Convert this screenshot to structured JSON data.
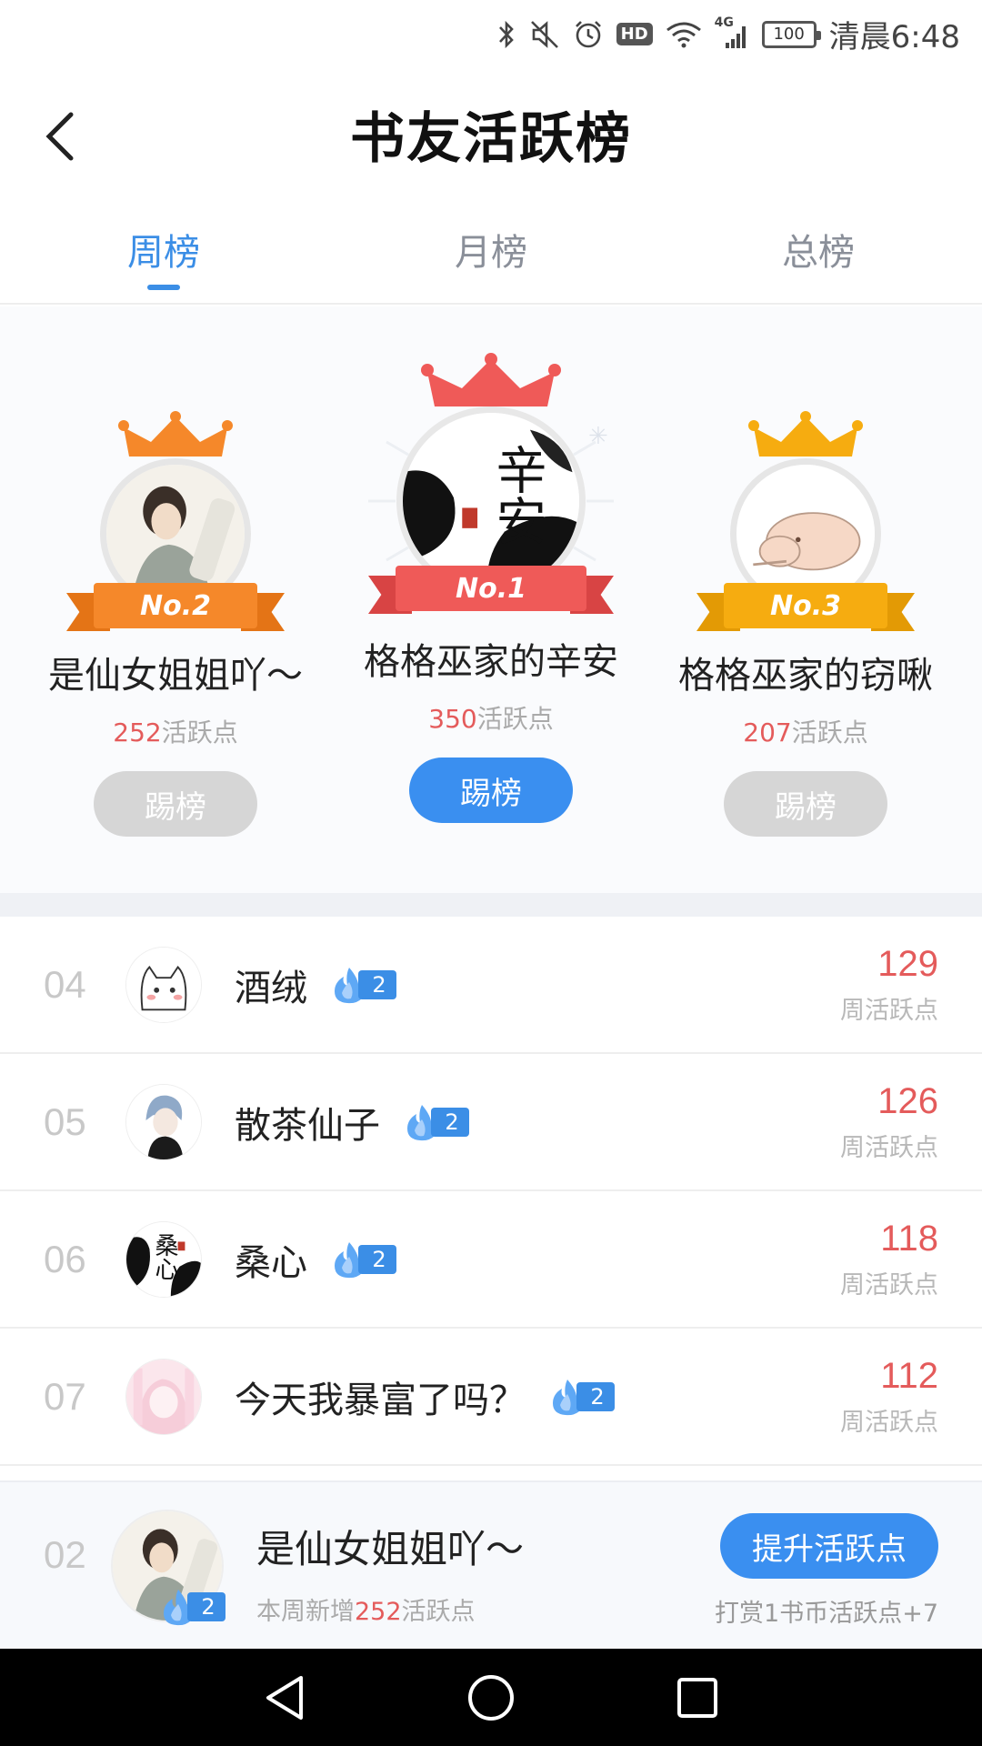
{
  "status_bar": {
    "battery": "100",
    "hd": "HD",
    "network": "4G",
    "time": "清晨6:48"
  },
  "header": {
    "title": "书友活跃榜"
  },
  "tabs": [
    {
      "label": "周榜",
      "active": true
    },
    {
      "label": "月榜",
      "active": false
    },
    {
      "label": "总榜",
      "active": false
    }
  ],
  "podium": {
    "first": {
      "badge": "No.1",
      "name": "格格巫家的辛安",
      "points": "350",
      "points_unit": "活跃点",
      "button": "踢榜",
      "avatar_text": "辛安"
    },
    "second": {
      "badge": "No.2",
      "name": "是仙女姐姐吖～",
      "points": "252",
      "points_unit": "活跃点",
      "button": "踢榜"
    },
    "third": {
      "badge": "No.3",
      "name": "格格巫家的窃啾",
      "points": "207",
      "points_unit": "活跃点",
      "button": "踢榜"
    }
  },
  "ranking": [
    {
      "rank": "04",
      "name": "酒绒",
      "level": "2",
      "score": "129",
      "unit": "周活跃点"
    },
    {
      "rank": "05",
      "name": "散茶仙子",
      "level": "2",
      "score": "126",
      "unit": "周活跃点"
    },
    {
      "rank": "06",
      "name": "桑心",
      "level": "2",
      "score": "118",
      "unit": "周活跃点",
      "avatar_text": "桑心"
    },
    {
      "rank": "07",
      "name": "今天我暴富了吗？",
      "level": "2",
      "score": "112",
      "unit": "周活跃点"
    }
  ],
  "my_rank": {
    "rank": "02",
    "name": "是仙女姐姐吖～",
    "level": "2",
    "sub_prefix": "本周新增",
    "sub_value": "252",
    "sub_suffix": "活跃点",
    "button": "提升活跃点",
    "tip": "打赏1书币活跃点+7"
  },
  "colors": {
    "accent": "#3a8ff0",
    "points_red": "#e45b5b",
    "gold": "#f6ac10",
    "orange": "#f5882a",
    "red": "#ef5a58"
  }
}
